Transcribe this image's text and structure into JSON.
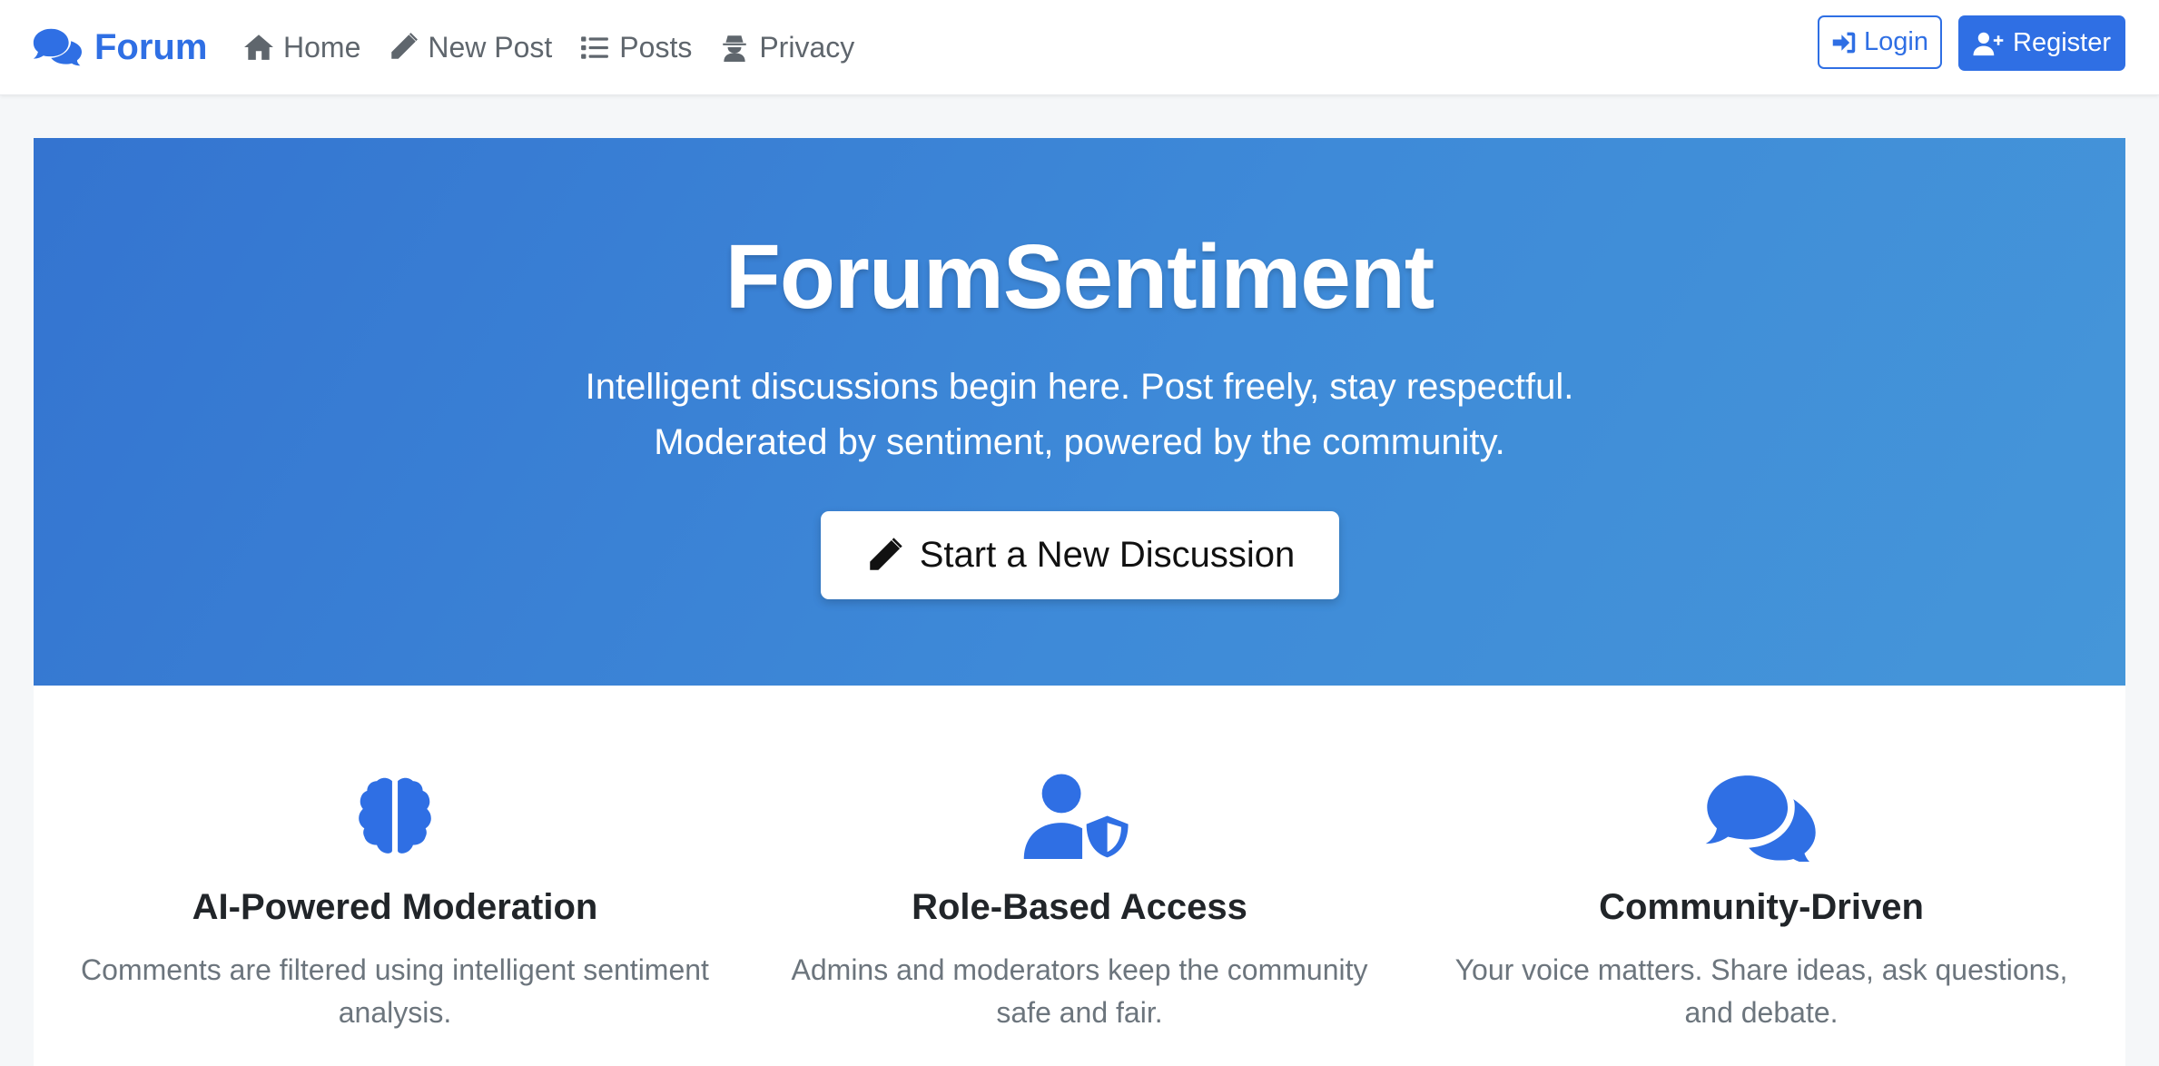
{
  "brand": {
    "name": "Forum",
    "icon": "comments-icon"
  },
  "nav": [
    {
      "label": "Home",
      "icon": "home-icon"
    },
    {
      "label": "New Post",
      "icon": "pencil-icon"
    },
    {
      "label": "Posts",
      "icon": "list-icon"
    },
    {
      "label": "Privacy",
      "icon": "user-secret-icon"
    }
  ],
  "auth": {
    "login_label": "Login",
    "register_label": "Register"
  },
  "hero": {
    "title": "ForumSentiment",
    "subtitle_line1": "Intelligent discussions begin here. Post freely, stay respectful.",
    "subtitle_line2": "Moderated by sentiment, powered by the community.",
    "cta_label": "Start a New Discussion"
  },
  "features": [
    {
      "icon": "brain-icon",
      "title": "AI-Powered Moderation",
      "desc_line1": "Comments are filtered using intelligent sentiment",
      "desc_line2": "analysis."
    },
    {
      "icon": "user-shield-icon",
      "title": "Role-Based Access",
      "desc_line1": "Admins and moderators keep the community",
      "desc_line2": "safe and fair."
    },
    {
      "icon": "comments-icon",
      "title": "Community-Driven",
      "desc_line1": "Your voice matters. Share ideas, ask questions,",
      "desc_line2": "and debate."
    }
  ],
  "colors": {
    "accent": "#2f6fe4",
    "hero_start": "#3474d0",
    "hero_end": "#4596d9"
  }
}
